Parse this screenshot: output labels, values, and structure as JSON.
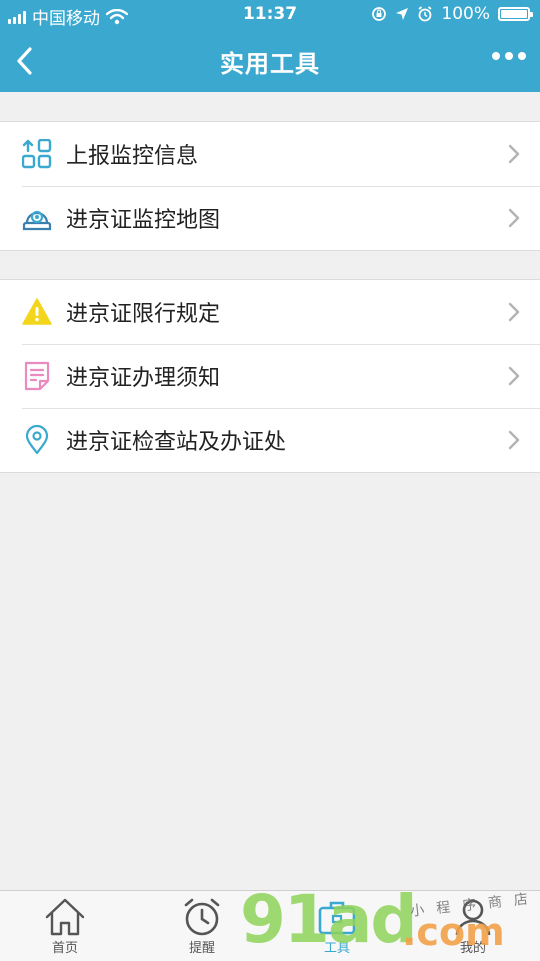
{
  "status_bar": {
    "carrier": "中国移动",
    "time": "11:37",
    "battery_text": "100%",
    "battery_level": 1.0
  },
  "nav": {
    "title": "实用工具",
    "back_icon": "chevron-left-icon",
    "more_icon": "more-dots-icon"
  },
  "groups": [
    {
      "items": [
        {
          "label": "上报监控信息",
          "icon": "upload-grid-icon",
          "icon_color": "#3ba9cf"
        },
        {
          "label": "进京证监控地图",
          "icon": "camera-icon",
          "icon_color": "#3b7fb0"
        }
      ]
    },
    {
      "items": [
        {
          "label": "进京证限行规定",
          "icon": "warning-icon",
          "icon_color": "#f3d51b"
        },
        {
          "label": "进京证办理须知",
          "icon": "document-icon",
          "icon_color": "#e98bc0"
        },
        {
          "label": "进京证检查站及办证处",
          "icon": "location-pin-icon",
          "icon_color": "#3ba9cf"
        }
      ]
    }
  ],
  "tabbar": {
    "tabs": [
      {
        "label": "首页",
        "icon": "home-icon"
      },
      {
        "label": "提醒",
        "icon": "alarm-clock-icon"
      },
      {
        "label": "工具",
        "icon": "toolbox-icon",
        "active": true
      },
      {
        "label": "我的",
        "icon": "user-icon"
      }
    ]
  },
  "watermark": {
    "brand": "91ad",
    "suffix": ".com",
    "tagline": "小程序商店"
  },
  "colors": {
    "primary": "#3ba9cf",
    "background": "#f0f0f0"
  }
}
